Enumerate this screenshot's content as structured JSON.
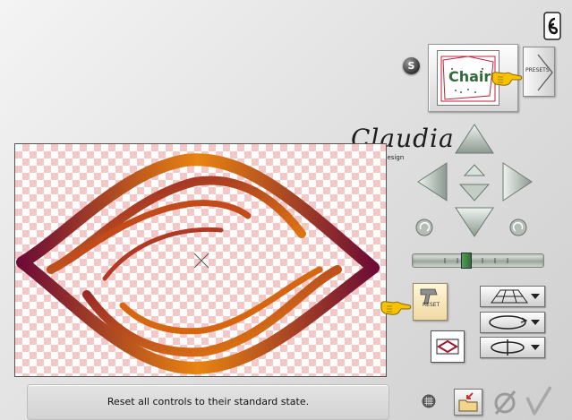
{
  "status": {
    "text": "Reset all controls to their standard state."
  },
  "presets": {
    "label": "PRESETS"
  },
  "reset": {
    "label": "RESET"
  },
  "badge": {
    "label": "S"
  },
  "signature": {
    "name": "Claudia",
    "sub": "CGSFWebdesign"
  },
  "preset_preview": {
    "word": "Chair"
  },
  "colors": {
    "canvas_checker": "#f5c7c7",
    "shape_dark": "#7a1232",
    "shape_light": "#e88410",
    "arrow_fill": "#c9d3cc",
    "hand_yellow": "#f6c200"
  },
  "icons": {
    "app_logo": "app-logo-icon",
    "pointer_hand": "pointing-hand-icon",
    "hammer": "hammer-icon",
    "grid": "grid-icon",
    "folder": "folder-arrow-icon",
    "cancel": "cancel-slash-icon",
    "ok": "checkmark-icon"
  }
}
